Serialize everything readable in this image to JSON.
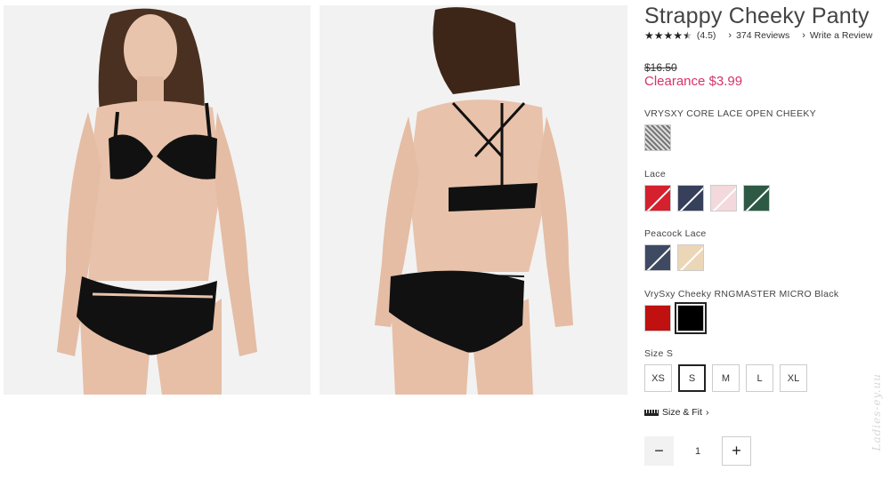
{
  "product": {
    "title": "Strappy Cheeky Panty",
    "rating": "(4.5)",
    "rating_value": 4.5,
    "reviews_link": "374 Reviews",
    "write_review_link": "Write a Review",
    "price_original": "$16.50",
    "price_sale": "Clearance $3.99"
  },
  "colors": {
    "accent_sale": "#d7326b"
  },
  "swatch_groups": [
    {
      "label": "VRYSXY CORE LACE OPEN CHEEKY",
      "swatches": [
        {
          "name": "grey-lace",
          "color": "#9a9a9a",
          "selected": false
        }
      ]
    },
    {
      "label": "Lace",
      "swatches": [
        {
          "name": "red-lace",
          "color": "#d5202e",
          "selected": false
        },
        {
          "name": "navy-lace",
          "color": "#36405a",
          "selected": false
        },
        {
          "name": "pink-lace",
          "color": "#f3d9dc",
          "selected": false
        },
        {
          "name": "green-lace",
          "color": "#2e5a45",
          "selected": false
        }
      ]
    },
    {
      "label": "Peacock Lace",
      "swatches": [
        {
          "name": "peacock-navy",
          "color": "#3e4a62",
          "selected": false
        },
        {
          "name": "peacock-nude",
          "color": "#ecd6b8",
          "selected": false
        }
      ]
    },
    {
      "label": "VrySxy Cheeky RNGMASTER MICRO Black",
      "swatches": [
        {
          "name": "red-micro",
          "color": "#c01010",
          "selected": false
        },
        {
          "name": "black-micro",
          "color": "#000000",
          "selected": true
        }
      ]
    }
  ],
  "size": {
    "label": "Size S",
    "options": [
      "XS",
      "S",
      "M",
      "L",
      "XL"
    ],
    "selected": "S"
  },
  "size_fit_link": "Size & Fit",
  "quantity": {
    "minus": "−",
    "value": "1",
    "plus": "+"
  },
  "watermark": "Ladies-ey.uu",
  "icons": {
    "star": "star-icon",
    "chevron": "chevron-right-icon",
    "ruler": "ruler-icon"
  }
}
